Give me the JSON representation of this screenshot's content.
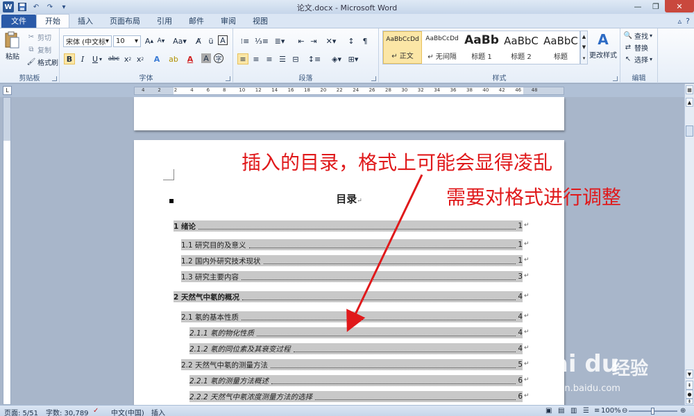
{
  "window": {
    "title": "论文.docx - Microsoft Word"
  },
  "tabs": [
    "文件",
    "开始",
    "插入",
    "页面布局",
    "引用",
    "邮件",
    "审阅",
    "视图"
  ],
  "ribbon": {
    "clipboard": {
      "label": "剪贴板",
      "paste": "粘贴",
      "cut": "剪切",
      "copy": "复制",
      "format_painter": "格式刷"
    },
    "font": {
      "label": "字体",
      "font_name": "宋体 (中文标题)",
      "font_size": "10"
    },
    "paragraph": {
      "label": "段落"
    },
    "styles": {
      "label": "样式",
      "items": [
        {
          "sample": "AaBbCcDd",
          "name": "↵ 正文"
        },
        {
          "sample": "AaBbCcDd",
          "name": "↵ 无间隔"
        },
        {
          "sample": "AaBb",
          "name": "标题 1"
        },
        {
          "sample": "AaBbC",
          "name": "标题 2"
        },
        {
          "sample": "AaBbC",
          "name": "标题"
        }
      ],
      "change_styles": "更改样式"
    },
    "editing": {
      "label": "编辑",
      "find": "查找",
      "replace": "替换",
      "select": "选择"
    }
  },
  "ruler": {
    "marks": [
      "4",
      "2",
      "2",
      "4",
      "6",
      "8",
      "10",
      "12",
      "14",
      "16",
      "18",
      "20",
      "22",
      "24",
      "26",
      "28",
      "30",
      "32",
      "34",
      "36",
      "38",
      "40",
      "42",
      "46",
      "48"
    ]
  },
  "document": {
    "toc_title": "目录",
    "toc": [
      {
        "level": 1,
        "text": "1  绪论",
        "page": "1"
      },
      {
        "level": 2,
        "text": "1.1  研究目的及意义",
        "page": "1"
      },
      {
        "level": 2,
        "text": "1.2  国内外研究技术现状",
        "page": "1"
      },
      {
        "level": 2,
        "text": "1.3  研究主要内容",
        "page": "3"
      },
      {
        "level": 1,
        "text": "2  天然气中氡的概况",
        "page": "4"
      },
      {
        "level": 2,
        "text": "2.1  氡的基本性质",
        "page": "4"
      },
      {
        "level": 3,
        "text": "2.1.1  氡的物化性质",
        "page": "4"
      },
      {
        "level": 3,
        "text": "2.1.2  氡的同位素及其衰变过程",
        "page": "4"
      },
      {
        "level": 2,
        "text": "2.2  天然气中氡的测量方法",
        "page": "5"
      },
      {
        "level": 3,
        "text": "2.2.1  氡的测量方法概述",
        "page": "6"
      },
      {
        "level": 3,
        "text": "2.2.2  天然气中氡浓度测量方法的选择",
        "page": "6"
      }
    ],
    "annotation_line1": "插入的目录，格式上可能会显得凌乱",
    "annotation_line2": "需要对格式进行调整"
  },
  "statusbar": {
    "page": "页面: 5/51",
    "words": "字数: 30,789",
    "language": "中文(中国)",
    "mode": "插入",
    "zoom": "100%"
  },
  "watermark": {
    "logo": "Bai du",
    "cn": "经验",
    "url": "jingyan.baidu.com"
  },
  "colors": {
    "annotation": "#e0191b",
    "file_tab": "#2a5aa8",
    "toc_shading": "#c8c8c8"
  }
}
